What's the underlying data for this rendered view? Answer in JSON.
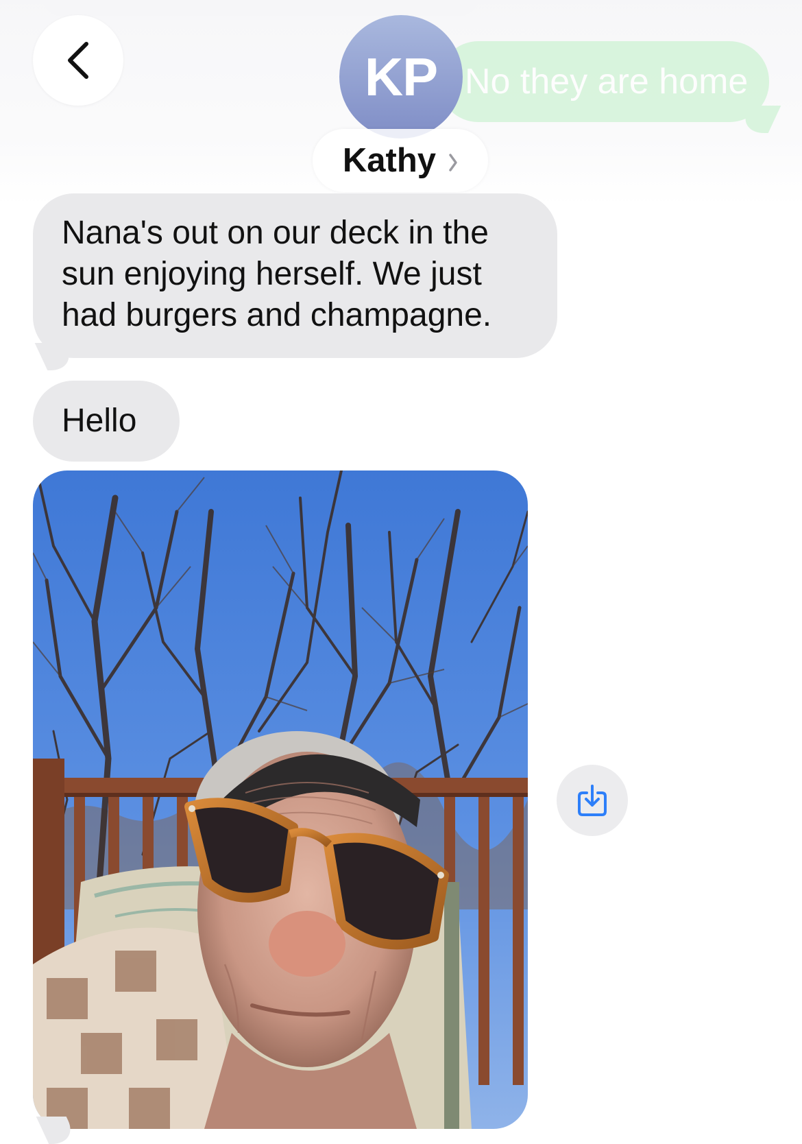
{
  "header": {
    "back_icon": "chevron-left-icon",
    "avatar_initials": "KP",
    "contact_name": "Kathy",
    "contact_chevron_icon": "chevron-right-icon",
    "colors": {
      "avatar_top": "#a9b8de",
      "avatar_bottom": "#7f8dc6",
      "header_background": "#f6f6f8"
    }
  },
  "messages": [
    {
      "direction": "sent",
      "text": "No they are home",
      "faded": true,
      "color": "#cdf3d3"
    },
    {
      "direction": "received",
      "text": "Nana's out on our deck in the sun enjoying herself. We just had burgers and champagne.",
      "color": "#e9e9eb"
    },
    {
      "direction": "received",
      "text": "Hello",
      "color": "#e9e9eb"
    },
    {
      "direction": "received",
      "type": "photo",
      "subject": "elderly woman with headband and orange sunglasses on a sunny deck, bare trees and blue sky behind"
    }
  ],
  "actions": {
    "save_icon": "save-to-photos-icon",
    "accent_color": "#2d7ff9"
  }
}
